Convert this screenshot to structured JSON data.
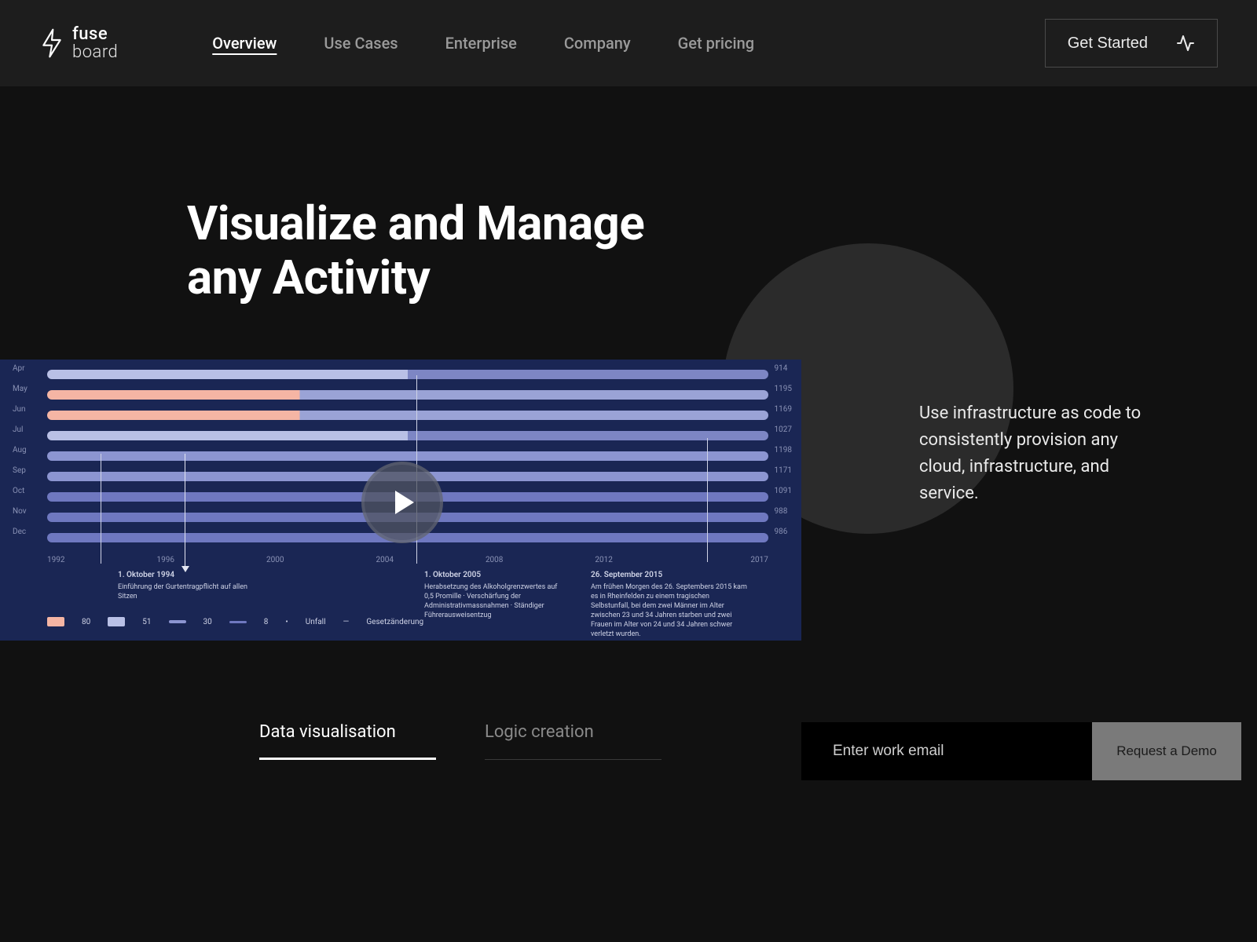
{
  "brand": {
    "line1": "fuse",
    "line2": "board"
  },
  "nav": {
    "items": [
      {
        "label": "Overview",
        "active": true
      },
      {
        "label": "Use Cases",
        "active": false
      },
      {
        "label": "Enterprise",
        "active": false
      },
      {
        "label": "Company",
        "active": false
      },
      {
        "label": "Get pricing",
        "active": false
      }
    ]
  },
  "header_cta": {
    "label": "Get Started"
  },
  "hero": {
    "title_line1": "Visualize and Manage",
    "title_line2": "any Activity",
    "copy": "Use infrastructure as code to consistently provision any cloud, infrastructure, and service."
  },
  "visual": {
    "y_left": [
      "Apr",
      "May",
      "Jun",
      "Jul",
      "Aug",
      "Sep",
      "Oct",
      "Nov",
      "Dec"
    ],
    "y_right": [
      "914",
      "1195",
      "1169",
      "1027",
      "1198",
      "1171",
      "1091",
      "988",
      "986"
    ],
    "x_ticks": [
      "1992",
      "",
      "1996",
      "",
      "2000",
      "",
      "2004",
      "",
      "2008",
      "",
      "2012",
      "",
      "",
      "2017"
    ],
    "legend": [
      {
        "value": "80",
        "class": "sw-80"
      },
      {
        "value": "51",
        "class": "sw-51"
      },
      {
        "value": "30",
        "class": "sw-30"
      },
      {
        "value": "8",
        "class": "sw-8"
      },
      {
        "value": "Unfall"
      },
      {
        "value": "Gesetzänderung"
      }
    ],
    "annotations": [
      {
        "title": "1. Oktober 1994",
        "body": "Einführung der Gurtentragpflicht auf allen Sitzen"
      },
      {
        "title": "1. Oktober 2005",
        "body": "Herabsetzung des Alkoholgrenzwertes auf 0,5 Promille · Verschärfung der Administrativmassnahmen · Ständiger Führerausweisentzug"
      },
      {
        "title": "26. September 2015",
        "body": "Am frühen Morgen des 26. Septembers 2015 kam es in Rheinfelden zu einem tragischen Selbstunfall, bei dem zwei Männer im Alter zwischen 23 und 34 Jahren starben und zwei Frauen im Alter von 24 und 34 Jahren schwer verletzt wurden."
      }
    ]
  },
  "tabs": [
    {
      "label": "Data visualisation",
      "active": true
    },
    {
      "label": "Logic creation",
      "active": false
    }
  ],
  "cta": {
    "placeholder": "Enter work email",
    "button": "Request a Demo"
  }
}
